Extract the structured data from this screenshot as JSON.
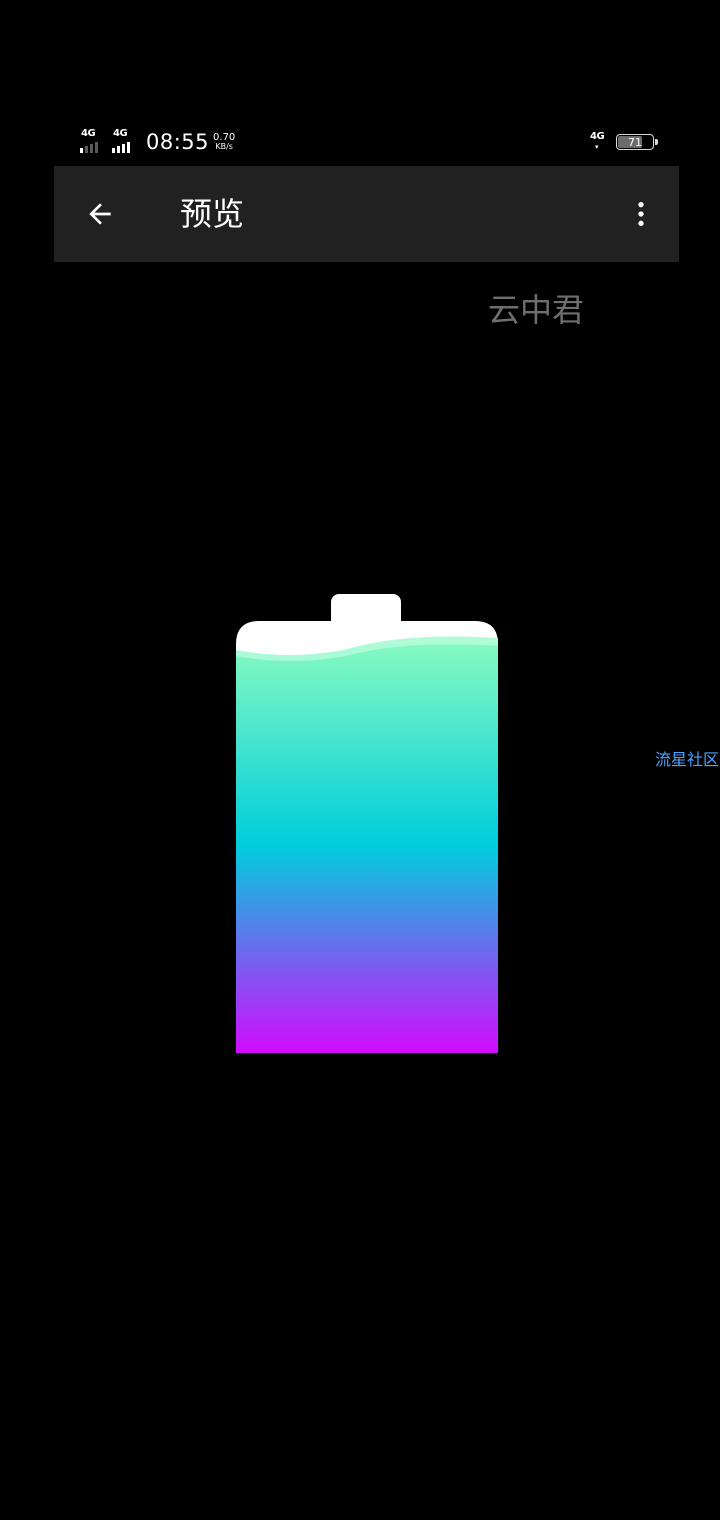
{
  "status_bar": {
    "sim1_network": "4G",
    "sim2_network": "4G",
    "time": "08:55",
    "speed_value": "0.70",
    "speed_unit": "KB/s",
    "data_network": "4G",
    "battery_level": "71"
  },
  "app_bar": {
    "back_icon": "arrow-left-icon",
    "title": "预览",
    "more_icon": "more-vert-icon"
  },
  "watermarks": {
    "top": "云中君",
    "side": "流星社区"
  },
  "preview": {
    "icon": "charging-battery-icon",
    "colors": {
      "top": "#8afbc0",
      "middle": "#00cedc",
      "bottom": "#d10cff",
      "cap": "#ffffff"
    }
  }
}
